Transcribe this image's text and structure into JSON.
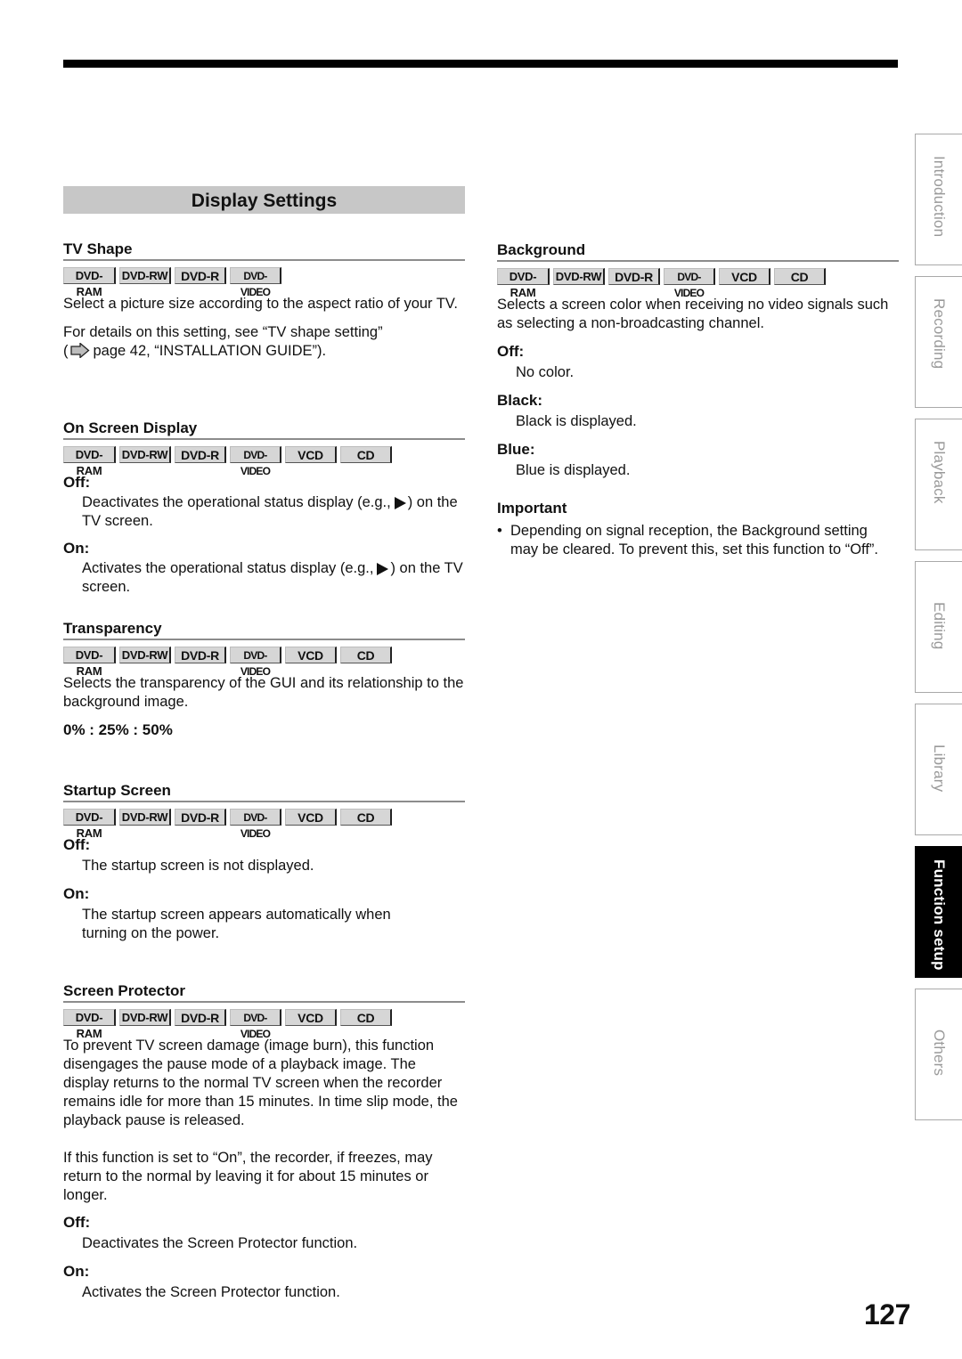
{
  "page": {
    "section_title": "Display Settings",
    "page_number": "127"
  },
  "disc_labels": {
    "dvd_ram": "DVD-RAM",
    "dvd_rw": "DVD-RW",
    "dvd_r": "DVD-R",
    "dvd_video": "DVD-VIDEO",
    "vcd": "VCD",
    "cd": "CD"
  },
  "tv_shape": {
    "title": "TV Shape",
    "description": "Select a picture size according to the aspect ratio of your TV.",
    "details_line1": "For details on this setting, see “TV shape setting”",
    "details_open": "(",
    "details_ref": "page 42, “INSTALLATION GUIDE”)."
  },
  "on_screen_display": {
    "title": "On Screen Display",
    "options": [
      {
        "label": "Off:",
        "desc_before": "Deactivates the operational status display (e.g.,",
        "desc_after": ") on the TV screen."
      },
      {
        "label": "On:",
        "desc_before": "Activates the operational status display (e.g.,",
        "desc_after": ") on the TV screen."
      }
    ]
  },
  "transparency": {
    "title": "Transparency",
    "description": "Selects the transparency of the GUI and its relationship to the background image.",
    "values": "0% : 25% : 50%"
  },
  "startup_screen": {
    "title": "Startup Screen",
    "options": [
      {
        "label": "Off:",
        "desc": "The startup screen is not displayed."
      },
      {
        "label": "On:",
        "desc": "The startup screen appears automatically when turning on the power."
      }
    ]
  },
  "screen_protector": {
    "title": "Screen Protector",
    "description1": "To prevent TV screen damage (image burn), this function disengages the pause mode of a playback image. The display returns to the normal TV screen when the recorder remains idle for more than 15 minutes. In time slip mode, the playback pause is released.",
    "description2": "If this function is set to “On”, the recorder, if freezes, may return to the normal by leaving it for about 15 minutes or longer.",
    "options": [
      {
        "label": "Off:",
        "desc": "Deactivates the Screen Protector function."
      },
      {
        "label": "On:",
        "desc": "Activates the Screen Protector function."
      }
    ]
  },
  "background": {
    "title": "Background",
    "description": "Selects a screen color when receiving no video signals such as selecting a non-broadcasting channel.",
    "options": [
      {
        "label": "Off:",
        "desc": "No color."
      },
      {
        "label": "Black:",
        "desc": "Black is displayed."
      },
      {
        "label": "Blue:",
        "desc": "Blue is displayed."
      }
    ]
  },
  "important": {
    "title": "Important",
    "bullet": "•",
    "items": [
      "Depending on signal reception, the Background setting may be cleared. To prevent this, set this function to “Off”."
    ]
  },
  "side_tabs": [
    {
      "label": "Introduction",
      "active": false
    },
    {
      "label": "Recording",
      "active": false
    },
    {
      "label": "Playback",
      "active": false
    },
    {
      "label": "Editing",
      "active": false
    },
    {
      "label": "Library",
      "active": false
    },
    {
      "label": "Function setup",
      "active": true
    },
    {
      "label": "Others",
      "active": false
    }
  ]
}
